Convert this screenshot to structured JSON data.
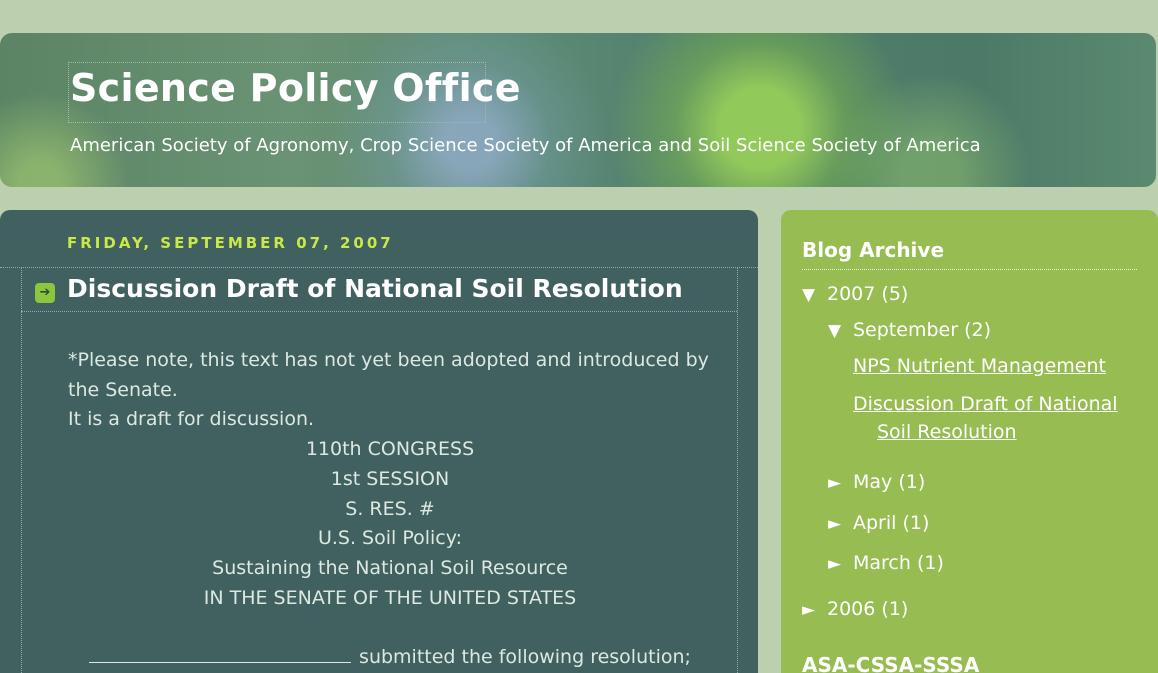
{
  "header": {
    "title": "Science Policy Office",
    "subtitle": "American Society of Agronomy, Crop Science Society of America and Soil Science Society of America"
  },
  "post": {
    "date": "FRIDAY, SEPTEMBER 07, 2007",
    "title": "Discussion Draft of National Soil Resolution",
    "icon": "arrow-right-icon",
    "lines_left": [
      "*Please note, this text has not yet been adopted and introduced by",
      "the Senate.",
      "It is a draft for discussion."
    ],
    "lines_center": [
      "110th CONGRESS",
      "1st SESSION",
      "S. RES. #",
      "U.S. Soil Policy:",
      "Sustaining the National Soil Resource",
      "IN THE SENATE OF THE UNITED STATES"
    ],
    "submitted": "submitted the following resolution;"
  },
  "sidebar": {
    "archive_title": "Blog Archive",
    "year_2007": "2007",
    "year_2007_count": "(5)",
    "september": "September",
    "september_count": "(2)",
    "post_link_1": "NPS Nutrient Management",
    "post_link_2a": "Discussion Draft of National",
    "post_link_2b": "Soil Resolution",
    "may": "May",
    "may_count": "(1)",
    "april": "April",
    "april_count": "(1)",
    "march": "March",
    "march_count": "(1)",
    "year_2006": "2006",
    "year_2006_count": "(1)",
    "section2_title": "ASA-CSSA-SSSA",
    "expanded_glyph": "▼",
    "collapsed_glyph": "►"
  },
  "colors": {
    "page_bg": "#bccfaf",
    "main_bg": "#416060",
    "sidebar_bg": "#97bc52",
    "date_color": "#c9e84a"
  }
}
